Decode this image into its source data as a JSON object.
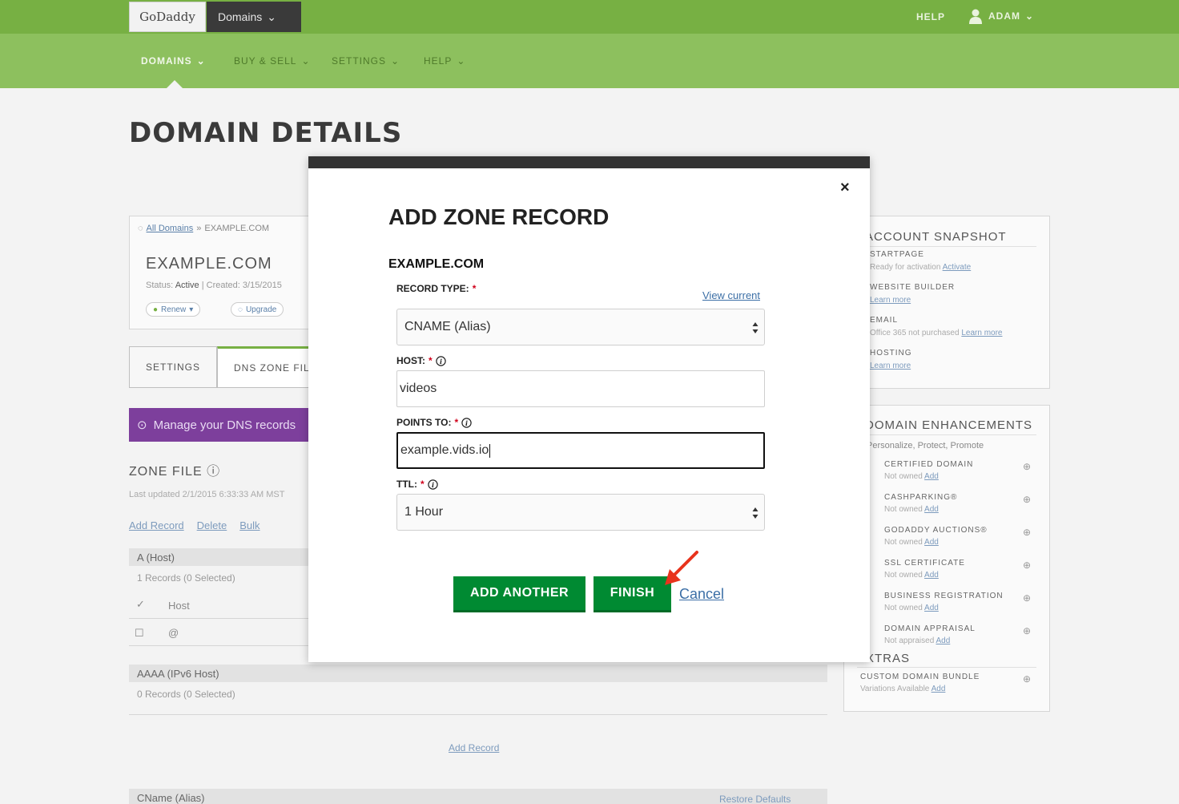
{
  "header": {
    "logo_text": "GoDaddy",
    "domains_pill": "Domains",
    "help": "HELP",
    "user": "ADAM"
  },
  "nav": {
    "items": [
      {
        "label": "DOMAINS"
      },
      {
        "label": "BUY & SELL"
      },
      {
        "label": "SETTINGS"
      },
      {
        "label": "HELP"
      }
    ]
  },
  "page": {
    "title": "DOMAIN DETAILS"
  },
  "domain_card": {
    "breadcrumb_link": "All Domains",
    "breadcrumb_sep": "»",
    "breadcrumb_current": "EXAMPLE.COM",
    "name": "EXAMPLE.COM",
    "status_label": "Status:",
    "status_value": "Active",
    "created": "Created: 3/15/2015",
    "renew": "Renew",
    "upgrade": "Upgrade"
  },
  "tabs": {
    "settings": "SETTINGS",
    "dns": "DNS ZONE FILE"
  },
  "promo": {
    "text": "Manage your DNS records"
  },
  "zone": {
    "title": "ZONE FILE",
    "updated": "Last updated 2/1/2015 6:33:33 AM MST",
    "actions": {
      "add": "Add Record",
      "delete": "Delete",
      "bulk": "Bulk"
    },
    "group_a": {
      "header": "A (Host)",
      "sub": "1 Records (0 Selected)",
      "col_host": "Host",
      "host_value": "@"
    },
    "group_aaaa": {
      "header": "AAAA (IPv6 Host)",
      "sub": "0 Records (0 Selected)"
    },
    "add_record_bottom": "Add Record",
    "group_cname": {
      "header": "CName (Alias)",
      "restore": "Restore Defaults"
    }
  },
  "sidebar": {
    "snapshot": {
      "title": "ACCOUNT SNAPSHOT",
      "items": [
        {
          "label": "STARTPAGE",
          "sub": "Ready for activation",
          "link": "Activate"
        },
        {
          "label": "WEBSITE BUILDER",
          "sub": "",
          "link": "Learn more"
        },
        {
          "label": "EMAIL",
          "sub": "Office 365 not purchased",
          "link": "Learn more"
        },
        {
          "label": "HOSTING",
          "sub": "",
          "link": "Learn more"
        }
      ]
    },
    "enhancements": {
      "title": "DOMAIN ENHANCEMENTS",
      "subtitle": "Personalize, Protect, Promote",
      "items": [
        {
          "label": "CERTIFIED DOMAIN",
          "sub": "Not owned",
          "link": "Add"
        },
        {
          "label": "CASHPARKING®",
          "sub": "Not owned",
          "link": "Add"
        },
        {
          "label": "GODADDY AUCTIONS®",
          "sub": "Not owned",
          "link": "Add"
        },
        {
          "label": "SSL CERTIFICATE",
          "sub": "Not owned",
          "link": "Add"
        },
        {
          "label": "BUSINESS REGISTRATION",
          "sub": "Not owned",
          "link": "Add"
        },
        {
          "label": "DOMAIN APPRAISAL",
          "sub": "Not appraised",
          "link": "Add"
        }
      ]
    },
    "extras": {
      "title": "EXTRAS",
      "items": [
        {
          "label": "CUSTOM DOMAIN BUNDLE",
          "sub": "Variations Available",
          "link": "Add"
        }
      ]
    }
  },
  "modal": {
    "close": "×",
    "title": "ADD ZONE RECORD",
    "domain": "EXAMPLE.COM",
    "record_type_label": "RECORD TYPE:",
    "view_current": "View current",
    "record_type_value": "CNAME (Alias)",
    "host_label": "HOST:",
    "host_value": "videos",
    "points_to_label": "POINTS TO:",
    "points_to_value": "example.vids.io",
    "ttl_label": "TTL:",
    "ttl_value": "1 Hour",
    "required_mark": "*",
    "add_another": "ADD ANOTHER",
    "finish": "FINISH",
    "cancel": "Cancel"
  },
  "colors": {
    "header_green": "#77b043",
    "nav_green": "#8dc05e",
    "button_green": "#008a32",
    "link_blue": "#3c6fa6",
    "required_red": "#d0021b",
    "promo_purple": "#7d3f9c"
  }
}
